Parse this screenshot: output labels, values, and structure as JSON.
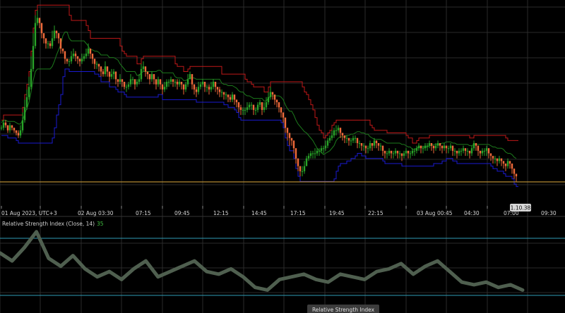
{
  "colors": {
    "background": "#000000",
    "grid": "#2a2a2a",
    "bull": "#28a428",
    "bear": "#f06a3a",
    "upper_band": "#c01818",
    "middle_band": "#1c7a1c",
    "lower_band": "#1a1ad0",
    "price_line": "#b38a32",
    "rsi_line": "#4f5f4f",
    "rsi_level": "#2f9db6"
  },
  "x_axis": {
    "labels": [
      "01 Aug 2023, UTC+3",
      "02 Aug 03:30",
      "07:15",
      "09:45",
      "12:15",
      "14:45",
      "17:15",
      "19:45",
      "22:15",
      "03 Aug 00:45",
      "04:30",
      "07:00",
      "09:30"
    ]
  },
  "price_tag": "1.10.38",
  "rsi": {
    "title": "Relative Strength Index (Close, 14)",
    "value": "35"
  },
  "tooltip": "Relative Strength Index",
  "chart_data": [
    {
      "type": "candlestick",
      "x": [
        2,
        5,
        8,
        11,
        14,
        17,
        20,
        23,
        26,
        29,
        32,
        35,
        38,
        41,
        44,
        47,
        50,
        53,
        56,
        59,
        62,
        65,
        68,
        71,
        74,
        77,
        80,
        83,
        86,
        89,
        92,
        95,
        98,
        101,
        104,
        107,
        110,
        113,
        116,
        119,
        122,
        125,
        128,
        131,
        134,
        137,
        140,
        143,
        146,
        149,
        152,
        155,
        158,
        161,
        164,
        167,
        170,
        173,
        176,
        179,
        182,
        185,
        188,
        191,
        194,
        197,
        200,
        203,
        206,
        209,
        212,
        215,
        218,
        221,
        224,
        227,
        230,
        233,
        236,
        239,
        242,
        245,
        248,
        251,
        254,
        257,
        260,
        263,
        266,
        269,
        272,
        275,
        278,
        281,
        284,
        287,
        290,
        293,
        296,
        299,
        302,
        305,
        308,
        311,
        314,
        317,
        320,
        323,
        326,
        329,
        332,
        335,
        338,
        341,
        344,
        347,
        350,
        353,
        356,
        359,
        362,
        365,
        368,
        371,
        374,
        377,
        380,
        383,
        386,
        389,
        392,
        395,
        398,
        401,
        404,
        407,
        410,
        413,
        416,
        419,
        422,
        425,
        428,
        431,
        434,
        437,
        440,
        443,
        446,
        449,
        452,
        455,
        458,
        461,
        464,
        467,
        470,
        473,
        476,
        479,
        482,
        485,
        488,
        491,
        494,
        497,
        500,
        503,
        506,
        509,
        512,
        515,
        518,
        521,
        524,
        527,
        530,
        533,
        536,
        539,
        542,
        545,
        548,
        551,
        554,
        557,
        560,
        563,
        566,
        569,
        572,
        575,
        578,
        581,
        584,
        587,
        590,
        593,
        596,
        599,
        602,
        605,
        608,
        611,
        614,
        617,
        620,
        623,
        626,
        629,
        632,
        635,
        638,
        641,
        644,
        647,
        650,
        653,
        656,
        659,
        662,
        665,
        668,
        671,
        674,
        677,
        680,
        683,
        686,
        689,
        692,
        695,
        698,
        701,
        704,
        707,
        710,
        713,
        716,
        719,
        722,
        725,
        728,
        731,
        734,
        737,
        740
      ],
      "close": [
        100,
        102,
        101,
        99,
        101,
        100,
        99,
        98,
        97,
        99,
        103,
        108,
        112,
        116,
        123,
        132,
        141,
        143,
        141,
        137,
        135,
        133,
        133,
        132,
        135,
        138,
        137,
        135,
        131,
        130,
        127,
        126,
        126,
        128,
        129,
        128,
        127,
        126,
        127,
        128,
        129,
        131,
        129,
        127,
        125,
        125,
        124,
        122,
        121,
        124,
        122,
        120,
        121,
        122,
        119,
        118,
        119,
        118,
        116,
        116,
        117,
        119,
        119,
        117,
        118,
        119,
        123,
        124,
        122,
        121,
        119,
        121,
        119,
        117,
        119,
        117,
        115,
        116,
        118,
        118,
        119,
        118,
        118,
        117,
        118,
        117,
        115,
        117,
        119,
        121,
        117,
        115,
        114,
        116,
        117,
        118,
        116,
        116,
        115,
        116,
        118,
        116,
        115,
        114,
        114,
        113,
        113,
        112,
        111,
        113,
        111,
        110,
        108,
        107,
        107,
        107,
        108,
        109,
        109,
        107,
        107,
        109,
        110,
        107,
        108,
        110,
        112,
        114,
        113,
        111,
        110,
        108,
        106,
        104,
        100,
        98,
        96,
        95,
        92,
        88,
        85,
        83,
        83,
        85,
        88,
        89,
        90,
        90,
        90,
        91,
        91,
        92,
        92,
        93,
        95,
        96,
        97,
        99,
        99,
        100,
        98,
        97,
        96,
        96,
        95,
        95,
        96,
        96,
        94,
        94,
        93,
        93,
        92,
        92,
        94,
        93,
        95,
        94,
        93,
        93,
        91,
        90,
        90,
        91,
        90,
        90,
        91,
        90,
        90,
        89,
        90,
        91,
        90,
        90,
        91,
        91,
        92,
        93,
        92,
        92,
        93,
        93,
        94,
        93,
        92,
        93,
        94,
        93,
        92,
        93,
        92,
        92,
        93,
        91,
        91,
        90,
        91,
        91,
        92,
        91,
        91,
        90,
        92,
        94,
        93,
        91,
        90,
        91,
        91,
        92,
        90,
        89,
        88,
        88,
        87,
        88,
        87,
        86,
        85,
        87,
        86,
        84,
        82,
        81
      ],
      "high": [
        101,
        103,
        103,
        101,
        102,
        101,
        100,
        99,
        99,
        101,
        106,
        111,
        115,
        120,
        128,
        137,
        144,
        146,
        142,
        139,
        136,
        134,
        134,
        134,
        138,
        140,
        138,
        136,
        132,
        131,
        128,
        127,
        127,
        130,
        131,
        130,
        128,
        127,
        129,
        129,
        131,
        133,
        130,
        128,
        127,
        126,
        125,
        124,
        123,
        126,
        123,
        122,
        123,
        123,
        121,
        119,
        121,
        119,
        118,
        117,
        118,
        121,
        120,
        118,
        119,
        121,
        125,
        126,
        123,
        122,
        121,
        122,
        120,
        119,
        120,
        118,
        117,
        118,
        119,
        119,
        120,
        119,
        119,
        119,
        119,
        118,
        117,
        118,
        121,
        122,
        118,
        116,
        116,
        118,
        118,
        119,
        117,
        117,
        117,
        118,
        119,
        117,
        116,
        116,
        115,
        114,
        114,
        113,
        113,
        114,
        112,
        111,
        109,
        109,
        108,
        108,
        110,
        110,
        110,
        108,
        108,
        110,
        111,
        109,
        110,
        112,
        114,
        116,
        114,
        112,
        111,
        109,
        107,
        105,
        102,
        99,
        97,
        96,
        94,
        89,
        86,
        84,
        85,
        87,
        89,
        90,
        91,
        91,
        92,
        92,
        92,
        93,
        93,
        95,
        96,
        97,
        99,
        100,
        101,
        101,
        99,
        98,
        97,
        97,
        96,
        96,
        97,
        97,
        95,
        95,
        94,
        94,
        93,
        93,
        95,
        94,
        96,
        95,
        94,
        94,
        92,
        91,
        91,
        92,
        91,
        91,
        92,
        91,
        91,
        90,
        91,
        92,
        91,
        91,
        92,
        92,
        93,
        94,
        93,
        93,
        94,
        94,
        95,
        94,
        93,
        94,
        95,
        94,
        93,
        94,
        93,
        93,
        94,
        92,
        92,
        91,
        92,
        92,
        93,
        92,
        92,
        91,
        93,
        95,
        94,
        92,
        91,
        92,
        92,
        93,
        91,
        90,
        89,
        89,
        88,
        89,
        88,
        87,
        86,
        88,
        87,
        85,
        83,
        82
      ],
      "low": [
        99,
        99,
        100,
        98,
        98,
        99,
        98,
        97,
        96,
        96,
        98,
        102,
        107,
        111,
        115,
        122,
        131,
        140,
        139,
        135,
        133,
        131,
        131,
        131,
        131,
        134,
        135,
        133,
        129,
        129,
        125,
        125,
        124,
        125,
        127,
        126,
        125,
        124,
        125,
        126,
        127,
        128,
        127,
        125,
        123,
        123,
        122,
        120,
        120,
        120,
        120,
        118,
        119,
        119,
        117,
        116,
        117,
        116,
        115,
        114,
        115,
        116,
        117,
        115,
        116,
        117,
        118,
        122,
        120,
        119,
        117,
        118,
        117,
        115,
        116,
        115,
        113,
        114,
        115,
        116,
        117,
        116,
        116,
        115,
        116,
        115,
        113,
        114,
        116,
        119,
        115,
        113,
        112,
        113,
        115,
        116,
        114,
        114,
        113,
        114,
        115,
        114,
        113,
        112,
        112,
        111,
        111,
        110,
        110,
        110,
        109,
        108,
        106,
        105,
        105,
        105,
        106,
        107,
        107,
        105,
        105,
        106,
        108,
        105,
        106,
        107,
        109,
        111,
        111,
        109,
        108,
        106,
        104,
        102,
        98,
        95,
        93,
        93,
        90,
        86,
        83,
        81,
        81,
        82,
        85,
        87,
        88,
        88,
        88,
        89,
        89,
        90,
        90,
        91,
        92,
        94,
        95,
        96,
        97,
        98,
        96,
        95,
        94,
        94,
        93,
        93,
        94,
        94,
        92,
        92,
        91,
        91,
        90,
        90,
        91,
        91,
        92,
        92,
        91,
        91,
        89,
        88,
        88,
        89,
        88,
        88,
        89,
        88,
        88,
        87,
        88,
        89,
        88,
        88,
        89,
        89,
        90,
        91,
        90,
        90,
        91,
        91,
        92,
        91,
        90,
        91,
        92,
        91,
        90,
        91,
        90,
        90,
        91,
        89,
        89,
        88,
        89,
        89,
        90,
        89,
        89,
        88,
        89,
        91,
        91,
        89,
        88,
        89,
        89,
        89,
        88,
        87,
        86,
        86,
        85,
        86,
        85,
        84,
        83,
        84,
        84,
        82,
        80,
        79
      ]
    },
    {
      "type": "line",
      "name": "",
      "x": [
        0,
        40,
        80,
        120,
        160,
        200,
        240,
        280,
        320,
        360,
        400,
        440,
        480,
        520,
        560,
        600,
        640,
        680,
        720,
        740
      ],
      "y": [
        1.1045,
        1.1046,
        1.104,
        1.1038,
        1.1035,
        1.1034,
        1.1031,
        1.1028,
        1.1025,
        1.1022,
        1.1018,
        1.1015,
        1.1013,
        1.1011,
        1.1009,
        1.1007,
        1.1006,
        1.1006,
        1.1005,
        1.1005
      ]
    },
    {
      "type": "line",
      "x": [
        0,
        50,
        100,
        150,
        200,
        250,
        300,
        350,
        400,
        450,
        500,
        550,
        600,
        650,
        700,
        740
      ],
      "y": [
        35,
        44,
        30,
        32,
        26,
        33,
        30,
        29,
        22,
        27,
        27,
        26,
        30,
        31,
        24,
        22
      ]
    }
  ]
}
